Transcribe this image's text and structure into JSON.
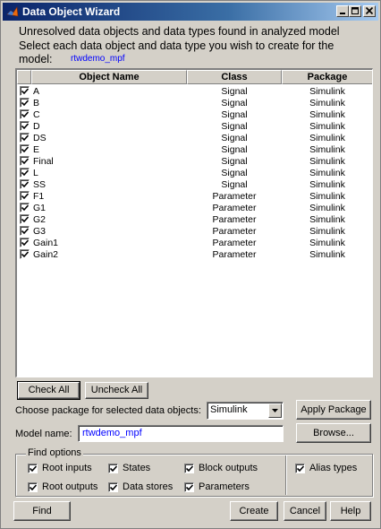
{
  "window": {
    "title": "Data Object Wizard"
  },
  "intro": {
    "line1": "Unresolved data objects and data types found in analyzed model",
    "line2": "Select each data object and data type you wish to create for the",
    "model_label": "model:",
    "model_name": "rtwdemo_mpf"
  },
  "table": {
    "columns": [
      "Object Name",
      "Class",
      "Package"
    ],
    "rows": [
      {
        "name": "A",
        "class": "Signal",
        "package": "Simulink",
        "checked": true
      },
      {
        "name": "B",
        "class": "Signal",
        "package": "Simulink",
        "checked": true
      },
      {
        "name": "C",
        "class": "Signal",
        "package": "Simulink",
        "checked": true
      },
      {
        "name": "D",
        "class": "Signal",
        "package": "Simulink",
        "checked": true
      },
      {
        "name": "DS",
        "class": "Signal",
        "package": "Simulink",
        "checked": true
      },
      {
        "name": "E",
        "class": "Signal",
        "package": "Simulink",
        "checked": true
      },
      {
        "name": "Final",
        "class": "Signal",
        "package": "Simulink",
        "checked": true
      },
      {
        "name": "L",
        "class": "Signal",
        "package": "Simulink",
        "checked": true
      },
      {
        "name": "SS",
        "class": "Signal",
        "package": "Simulink",
        "checked": true
      },
      {
        "name": "F1",
        "class": "Parameter",
        "package": "Simulink",
        "checked": true
      },
      {
        "name": "G1",
        "class": "Parameter",
        "package": "Simulink",
        "checked": true
      },
      {
        "name": "G2",
        "class": "Parameter",
        "package": "Simulink",
        "checked": true
      },
      {
        "name": "G3",
        "class": "Parameter",
        "package": "Simulink",
        "checked": true
      },
      {
        "name": "Gain1",
        "class": "Parameter",
        "package": "Simulink",
        "checked": true
      },
      {
        "name": "Gain2",
        "class": "Parameter",
        "package": "Simulink",
        "checked": true
      }
    ]
  },
  "buttons": {
    "check_all": "Check All",
    "uncheck_all": "Uncheck All",
    "apply_package": "Apply Package",
    "browse": "Browse...",
    "find": "Find",
    "create": "Create",
    "cancel": "Cancel",
    "help": "Help"
  },
  "package_select": {
    "label": "Choose package for selected data objects:",
    "value": "Simulink"
  },
  "model_field": {
    "label": "Model name:",
    "value": "rtwdemo_mpf"
  },
  "find_options": {
    "title": "Find options",
    "options": [
      {
        "label": "Root inputs",
        "checked": true
      },
      {
        "label": "States",
        "checked": true
      },
      {
        "label": "Block outputs",
        "checked": true
      },
      {
        "label": "Root outputs",
        "checked": true
      },
      {
        "label": "Data stores",
        "checked": true
      },
      {
        "label": "Parameters",
        "checked": true
      }
    ],
    "alias_types": {
      "label": "Alias types",
      "checked": true
    }
  },
  "colors": {
    "title_start": "#0a246a",
    "title_end": "#a6caf0",
    "dialog_bg": "#d4d0c8",
    "link": "#0000ff"
  },
  "icons": [
    "matlab-icon",
    "minimize-icon",
    "maximize-icon",
    "close-icon",
    "checkmark-icon",
    "dropdown-arrow-icon"
  ]
}
